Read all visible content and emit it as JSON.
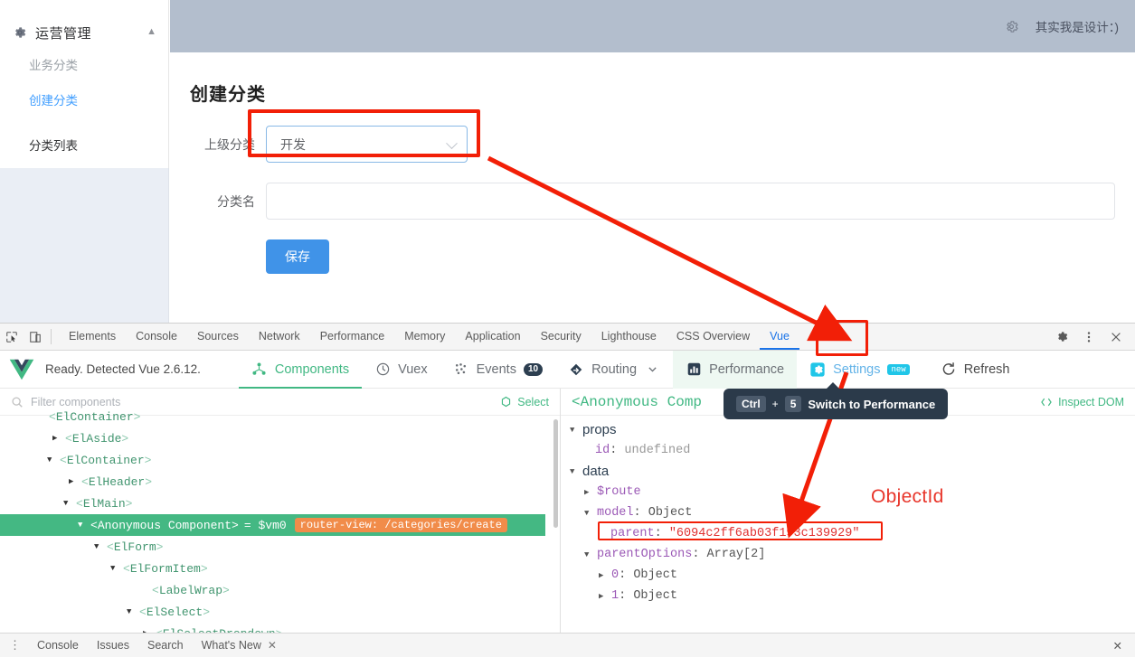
{
  "app": {
    "sidebar": {
      "group_title": "运营管理",
      "collapse_icon": "chevron-up-icon",
      "items": [
        {
          "label": "业务分类",
          "state": "muted"
        },
        {
          "label": "创建分类",
          "state": "active"
        },
        {
          "label": "分类列表",
          "state": "normal"
        }
      ]
    },
    "header": {
      "gear_icon": "gear-icon",
      "text": "其实我是设计：)"
    },
    "main": {
      "title": "创建分类",
      "fields": [
        {
          "label": "上级分类",
          "type": "select",
          "value": "开发"
        },
        {
          "label": "分类名",
          "type": "input",
          "value": "",
          "placeholder": ""
        }
      ],
      "save_label": "保存"
    }
  },
  "annotations": {
    "objectid_label": "ObjectId",
    "highlight_color": "#f21f07"
  },
  "devtools": {
    "left_icons": [
      "inspect-element-icon",
      "device-toolbar-icon"
    ],
    "tabs": [
      "Elements",
      "Console",
      "Sources",
      "Network",
      "Performance",
      "Memory",
      "Application",
      "Security",
      "Lighthouse",
      "CSS Overview",
      "Vue"
    ],
    "active_tab": "Vue",
    "right_icons": [
      "gear-icon",
      "more-vertical-icon",
      "close-icon"
    ],
    "statusbar": {
      "items": [
        "Console",
        "Issues",
        "Search",
        "What's New"
      ],
      "close_label": "✕",
      "right_close": "✕"
    }
  },
  "vue_panel": {
    "status": "Ready. Detected Vue 2.6.12.",
    "tabs": [
      {
        "label": "Components",
        "icon": "components-icon",
        "state": "active"
      },
      {
        "label": "Vuex",
        "icon": "history-icon",
        "state": "normal"
      },
      {
        "label": "Events",
        "icon": "events-icon",
        "badge": "10",
        "state": "normal"
      },
      {
        "label": "Routing",
        "icon": "routing-icon",
        "caret": "chevron-down-icon",
        "state": "normal"
      },
      {
        "label": "Performance",
        "icon": "performance-icon",
        "state": "hovered"
      },
      {
        "label": "Settings",
        "icon": "settings-icon",
        "badge": "new",
        "state": "normal"
      },
      {
        "label": "Refresh",
        "icon": "refresh-icon",
        "state": "normal"
      }
    ],
    "tooltip": {
      "key": "Ctrl",
      "plus": "+",
      "key2": "5",
      "text": "Switch to Performance"
    },
    "filter": {
      "placeholder": "Filter components",
      "value": "",
      "select_label": "Select",
      "select_icon": "target-icon"
    },
    "component_tree": [
      {
        "indent": 1,
        "tri": "",
        "name": "ElContainer",
        "selected": false,
        "clipped": true
      },
      {
        "indent": 2,
        "tri": "▶",
        "name": "ElAside",
        "selected": false
      },
      {
        "indent": 2,
        "tri": "▼",
        "name": "ElContainer",
        "selected": false
      },
      {
        "indent": 3,
        "tri": "▶",
        "name": "ElHeader",
        "selected": false
      },
      {
        "indent": 3,
        "tri": "▼",
        "name": "ElMain",
        "selected": false
      },
      {
        "indent": 4,
        "tri": "▼",
        "name": "Anonymous Component",
        "selected": true,
        "vm": "= $vm0",
        "badge": "router-view: /categories/create"
      },
      {
        "indent": 5,
        "tri": "▼",
        "name": "ElForm",
        "selected": false
      },
      {
        "indent": 6,
        "tri": "▼",
        "name": "ElFormItem",
        "selected": false
      },
      {
        "indent": 7,
        "tri": "",
        "name": "LabelWrap",
        "selected": false
      },
      {
        "indent": 7,
        "tri": "▼",
        "name": "ElSelect",
        "selected": false
      },
      {
        "indent": 8,
        "tri": "▶",
        "name": "ElSelectDropdown",
        "selected": false,
        "clipped": true
      }
    ],
    "inspector": {
      "title": "<Anonymous Comp",
      "inspect_dom_label": "Inspect DOM",
      "inspect_dom_icon": "code-brackets-icon",
      "sections": [
        {
          "indent": 0,
          "tri": "▼",
          "kind": "section",
          "label": "props"
        },
        {
          "indent": 1,
          "tri": "",
          "kind": "kv",
          "key": "id",
          "value": "undefined",
          "vtype": "undef"
        },
        {
          "indent": 0,
          "tri": "▼",
          "kind": "section",
          "label": "data"
        },
        {
          "indent": 1,
          "tri": "▶",
          "kind": "key",
          "key": "$route"
        },
        {
          "indent": 1,
          "tri": "▼",
          "kind": "kv",
          "key": "model",
          "value": "Object",
          "vtype": "type"
        },
        {
          "indent": 2,
          "tri": "",
          "kind": "kv",
          "key": "parent",
          "value": "\"6094c2ff6ab03f193c139929\"",
          "vtype": "str",
          "highlighted": true
        },
        {
          "indent": 1,
          "tri": "▼",
          "kind": "kv",
          "key": "parentOptions",
          "value": "Array[2]",
          "vtype": "type"
        },
        {
          "indent": 2,
          "tri": "▶",
          "kind": "kv",
          "key": "0",
          "value": "Object",
          "vtype": "type"
        },
        {
          "indent": 2,
          "tri": "▶",
          "kind": "kv",
          "key": "1",
          "value": "Object",
          "vtype": "type"
        }
      ]
    }
  }
}
